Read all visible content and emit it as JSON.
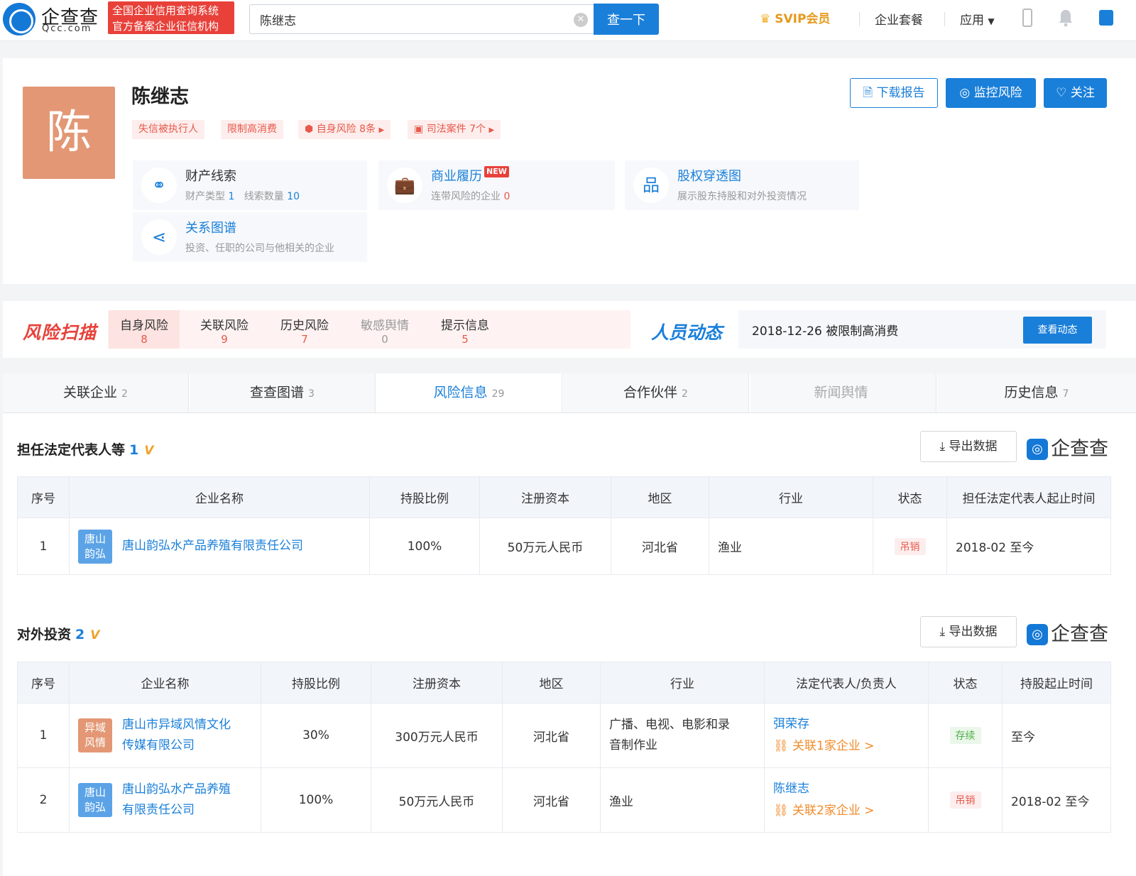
{
  "header": {
    "logo_text": "企查查",
    "logo_domain": "Qcc.com",
    "logo_badge_line1": "全国企业信用查询系统",
    "logo_badge_line2": "官方备案企业征信机构",
    "search_value": "陈继志",
    "search_button": "查一下",
    "svip": "SVIP会员",
    "nav_package": "企业套餐",
    "nav_apps": "应用"
  },
  "profile": {
    "avatar_char": "陈",
    "name": "陈继志",
    "tags": [
      "失信被执行人",
      "限制高消费",
      "自身风险 8条",
      "司法案件 7个"
    ],
    "actions": {
      "download": "下载报告",
      "monitor": "监控风险",
      "follow": "关注"
    },
    "cards": [
      {
        "title": "财产线索",
        "desc_a": "财产类型",
        "val_a": "1",
        "desc_b": "线索数量",
        "val_b": "10"
      },
      {
        "title": "商业履历",
        "badge": "NEW",
        "desc": "连带风险的企业",
        "val": "0"
      },
      {
        "title": "股权穿透图",
        "desc": "展示股东持股和对外投资情况"
      },
      {
        "title": "关系图谱",
        "desc": "投资、任职的公司与他相关的企业"
      }
    ]
  },
  "risk": {
    "logo": "风险扫描",
    "tabs": [
      {
        "label": "自身风险",
        "count": "8"
      },
      {
        "label": "关联风险",
        "count": "9"
      },
      {
        "label": "历史风险",
        "count": "7"
      },
      {
        "label": "敏感舆情",
        "count": "0"
      },
      {
        "label": "提示信息",
        "count": "5"
      }
    ],
    "people_logo": "人员动态",
    "people_text": "2018-12-26 被限制高消费",
    "people_button": "查看动态"
  },
  "tabs": [
    {
      "label": "关联企业",
      "count": "2"
    },
    {
      "label": "查查图谱",
      "count": "3"
    },
    {
      "label": "风险信息",
      "count": "29"
    },
    {
      "label": "合作伙伴",
      "count": "2"
    },
    {
      "label": "新闻舆情",
      "count": ""
    },
    {
      "label": "历史信息",
      "count": "7"
    }
  ],
  "section1": {
    "title": "担任法定代表人等",
    "count": "1",
    "vip": "VIP",
    "export": "导出数据",
    "watermark": "企查查",
    "columns": [
      "序号",
      "企业名称",
      "持股比例",
      "注册资本",
      "地区",
      "行业",
      "状态",
      "担任法定代表人起止时间"
    ],
    "rows": [
      {
        "no": "1",
        "logo1": "唐山",
        "logo2": "韵弘",
        "name": "唐山韵弘水产品养殖有限责任公司",
        "ratio": "100%",
        "capital": "50万元人民币",
        "region": "河北省",
        "industry": "渔业",
        "status": "吊销",
        "period": "2018-02 至今"
      }
    ]
  },
  "section2": {
    "title": "对外投资",
    "count": "2",
    "vip": "VIP",
    "export": "导出数据",
    "watermark": "企查查",
    "columns": [
      "序号",
      "企业名称",
      "持股比例",
      "注册资本",
      "地区",
      "行业",
      "法定代表人/负责人",
      "状态",
      "持股起止时间"
    ],
    "rows": [
      {
        "no": "1",
        "logo1": "异域",
        "logo2": "风情",
        "name1": "唐山市异域风情文化",
        "name2": "传媒有限公司",
        "ratio": "30%",
        "capital": "300万元人民币",
        "region": "河北省",
        "industry1": "广播、电视、电影和录",
        "industry2": "音制作业",
        "rep": "弭荣存",
        "rep_link": "关联1家企业 >",
        "status": "存续",
        "period": "至今"
      },
      {
        "no": "2",
        "logo1": "唐山",
        "logo2": "韵弘",
        "name1": "唐山韵弘水产品养殖",
        "name2": "有限责任公司",
        "ratio": "100%",
        "capital": "50万元人民币",
        "region": "河北省",
        "industry1": "渔业",
        "industry2": "",
        "rep": "陈继志",
        "rep_link": "关联2家企业 >",
        "status": "吊销",
        "period": "2018-02 至今"
      }
    ]
  },
  "colors": {
    "brand": "#1a7fd9",
    "danger": "#e8413a",
    "vip": "#f0a228"
  }
}
